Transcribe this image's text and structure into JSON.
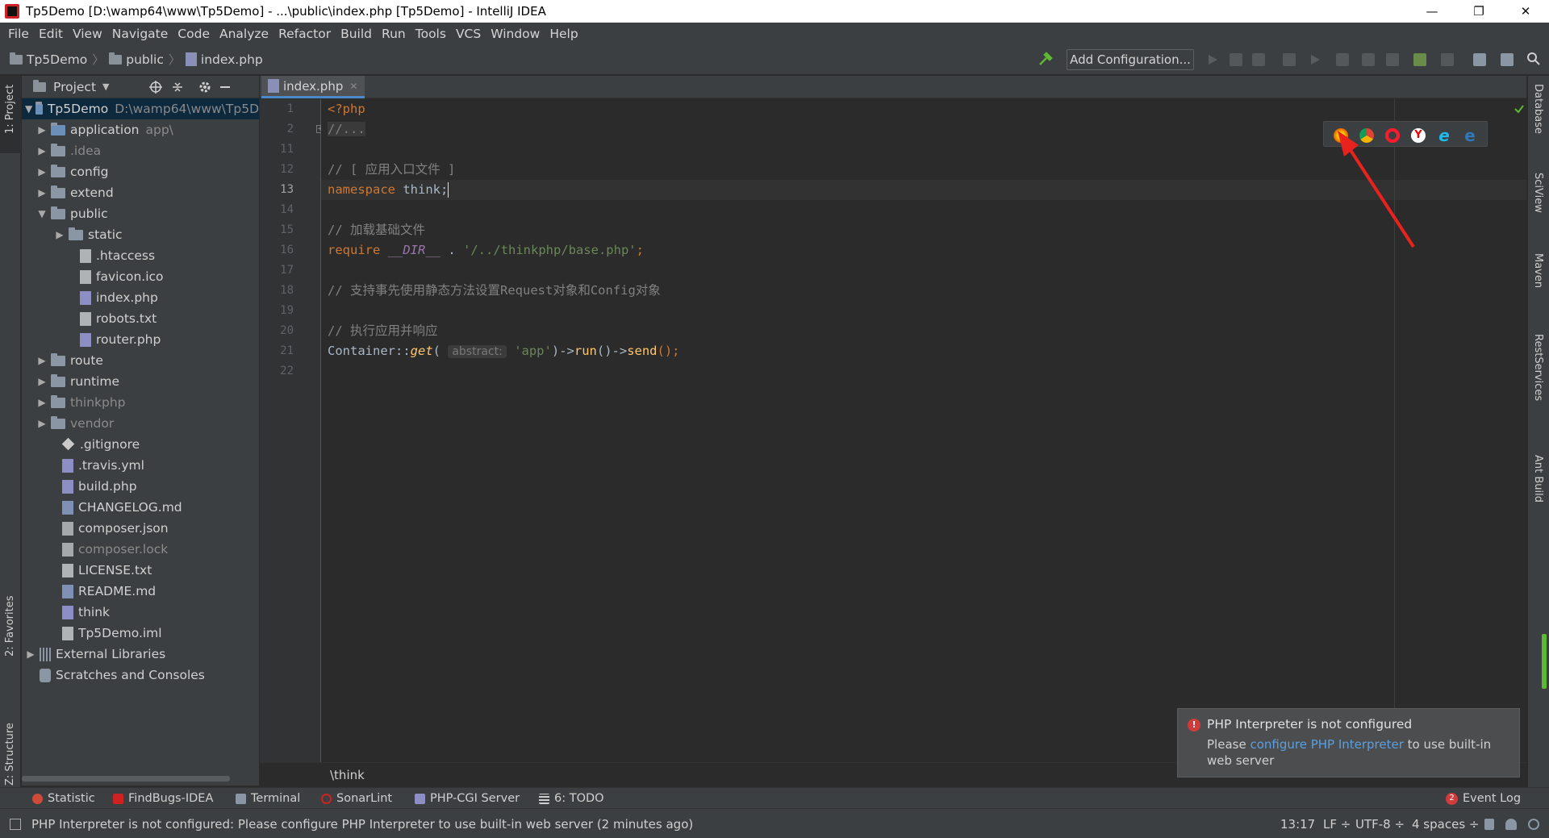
{
  "window": {
    "title": "Tp5Demo [D:\\wamp64\\www\\Tp5Demo] - ...\\public\\index.php [Tp5Demo] - IntelliJ IDEA",
    "minimize": "—",
    "restore": "❐",
    "close": "✕"
  },
  "menu": [
    "File",
    "Edit",
    "View",
    "Navigate",
    "Code",
    "Analyze",
    "Refactor",
    "Build",
    "Run",
    "Tools",
    "VCS",
    "Window",
    "Help"
  ],
  "breadcrumb": {
    "project": "Tp5Demo",
    "folder": "public",
    "file": "index.php"
  },
  "toolbar": {
    "add_configuration": "Add Configuration..."
  },
  "left_strip": {
    "project_tab": "1: Project",
    "favorites_tab": "2: Favorites",
    "structure_tab": "Z: Structure"
  },
  "project_panel": {
    "title": "Project",
    "tree": [
      {
        "label": "Tp5Demo",
        "hint": "D:\\wamp64\\www\\Tp5D",
        "type": "root",
        "expanded": true
      },
      {
        "label": "application",
        "hint": "app\\",
        "type": "folder"
      },
      {
        "label": ".idea",
        "type": "folder",
        "dim": true
      },
      {
        "label": "config",
        "type": "folder"
      },
      {
        "label": "extend",
        "type": "folder"
      },
      {
        "label": "public",
        "type": "folder",
        "expanded": true
      },
      {
        "label": "static",
        "type": "folder"
      },
      {
        "label": ".htaccess",
        "type": "file"
      },
      {
        "label": "favicon.ico",
        "type": "file"
      },
      {
        "label": "index.php",
        "type": "php"
      },
      {
        "label": "robots.txt",
        "type": "file"
      },
      {
        "label": "router.php",
        "type": "php"
      },
      {
        "label": "route",
        "type": "folder"
      },
      {
        "label": "runtime",
        "type": "folder"
      },
      {
        "label": "thinkphp",
        "type": "folder",
        "dim": true
      },
      {
        "label": "vendor",
        "type": "folder",
        "dim": true
      },
      {
        "label": ".gitignore",
        "type": "git"
      },
      {
        "label": ".travis.yml",
        "type": "yml"
      },
      {
        "label": "build.php",
        "type": "php"
      },
      {
        "label": "CHANGELOG.md",
        "type": "md"
      },
      {
        "label": "composer.json",
        "type": "json"
      },
      {
        "label": "composer.lock",
        "type": "json",
        "dim": true
      },
      {
        "label": "LICENSE.txt",
        "type": "file"
      },
      {
        "label": "README.md",
        "type": "md"
      },
      {
        "label": "think",
        "type": "php"
      },
      {
        "label": "Tp5Demo.iml",
        "type": "file"
      },
      {
        "label": "External Libraries",
        "type": "lib"
      },
      {
        "label": "Scratches and Consoles",
        "type": "scratch"
      }
    ]
  },
  "editor": {
    "tab": "index.php",
    "line_numbers": [
      "1",
      "2",
      "11",
      "12",
      "13",
      "14",
      "15",
      "16",
      "17",
      "18",
      "19",
      "20",
      "21",
      "22"
    ],
    "lines": {
      "l1": "<?php",
      "l2": "//...",
      "l12": "// [ 应用入口文件 ]",
      "l13_kw": "namespace",
      "l13_rest": " think;",
      "l15": "// 加载基础文件",
      "l16_kw": "require",
      "l16_const": "__DIR__",
      "l16_dot": " . ",
      "l16_str": "'/../thinkphp/base.php'",
      "l16_end": ";",
      "l18": "// 支持事先使用静态方法设置Request对象和Config对象",
      "l20": "// 执行应用并响应",
      "l21_a": "Container::",
      "l21_get": "get",
      "l21_paren": "(",
      "l21_hint": "abstract:",
      "l21_str": "'app'",
      "l21_b": ")->",
      "l21_run": "run",
      "l21_c": "()->",
      "l21_send": "send",
      "l21_d": "();"
    },
    "namespace_crumb": "\\think"
  },
  "notification": {
    "title": "PHP Interpreter is not configured",
    "prefix": "Please ",
    "link": "configure PHP Interpreter",
    "suffix": " to use built-in web server"
  },
  "right_strip": [
    "Database",
    "SciView",
    "Maven",
    "RestServices",
    "Ant Build"
  ],
  "bottom_tools": [
    "Statistic",
    "FindBugs-IDEA",
    "Terminal",
    "SonarLint",
    "PHP-CGI Server",
    "6: TODO"
  ],
  "event_log": {
    "count": "2",
    "label": "Event Log"
  },
  "status": {
    "message": "PHP Interpreter is not configured: Please configure PHP Interpreter to use built-in web server (2 minutes ago)",
    "position": "13:17",
    "line_sep": "LF ÷",
    "encoding": "UTF-8 ÷",
    "indent": "4 spaces ÷"
  },
  "colors": {
    "accent": "#4a88c7",
    "error": "#d03b3b",
    "link": "#5a9fe0",
    "keyword": "#cc7832",
    "string": "#6a8759"
  }
}
